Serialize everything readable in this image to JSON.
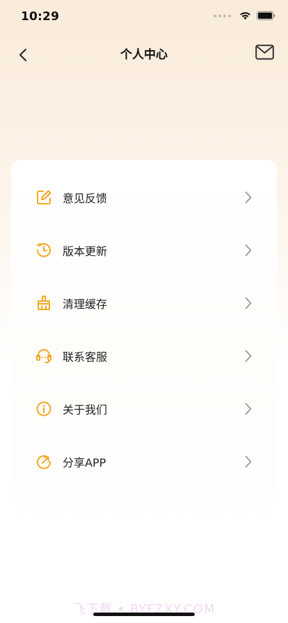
{
  "status_bar": {
    "time": "10:29"
  },
  "nav": {
    "title": "个人中心",
    "back_icon": "chevron-left-icon",
    "mail_icon": "mail-icon"
  },
  "menu": {
    "accent_color": "#f5a623",
    "items": [
      {
        "label": "意见反馈",
        "icon": "edit-icon"
      },
      {
        "label": "版本更新",
        "icon": "update-clock-icon"
      },
      {
        "label": "清理缓存",
        "icon": "broom-icon"
      },
      {
        "label": "联系客服",
        "icon": "headset-icon"
      },
      {
        "label": "关于我们",
        "icon": "info-icon"
      },
      {
        "label": "分享APP",
        "icon": "share-icon"
      }
    ]
  },
  "watermark": "飞下载 • BYFZXY.COM"
}
